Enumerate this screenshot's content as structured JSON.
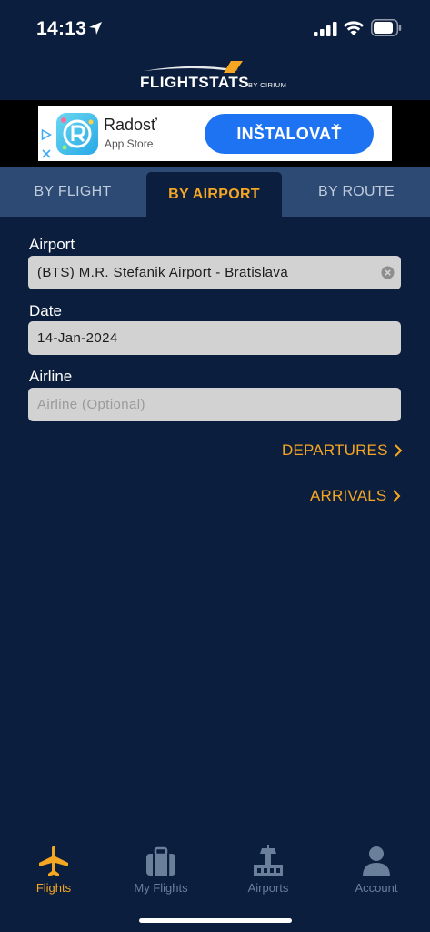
{
  "status": {
    "time": "14:13"
  },
  "ad": {
    "app_name": "Radosť",
    "store": "App Store",
    "install_label": "INŠTALOVAŤ"
  },
  "tabs": [
    {
      "label": "BY FLIGHT"
    },
    {
      "label": "BY AIRPORT",
      "active": true
    },
    {
      "label": "BY ROUTE"
    }
  ],
  "form": {
    "airport": {
      "label": "Airport",
      "value": "(BTS) M.R. Stefanik Airport - Bratislava"
    },
    "date": {
      "label": "Date",
      "value": "14-Jan-2024"
    },
    "airline": {
      "label": "Airline",
      "placeholder": "Airline (Optional)"
    }
  },
  "links": {
    "departures": "DEPARTURES",
    "arrivals": "ARRIVALS"
  },
  "nav": [
    {
      "label": "Flights",
      "icon": "airplane-icon",
      "active": true
    },
    {
      "label": "My Flights",
      "icon": "suitcase-icon"
    },
    {
      "label": "Airports",
      "icon": "control-tower-icon"
    },
    {
      "label": "Account",
      "icon": "person-icon"
    }
  ],
  "colors": {
    "background": "#0c1e3d",
    "tab_bar": "#2d4a74",
    "accent": "#f5a623",
    "install_button": "#1d73f1"
  }
}
